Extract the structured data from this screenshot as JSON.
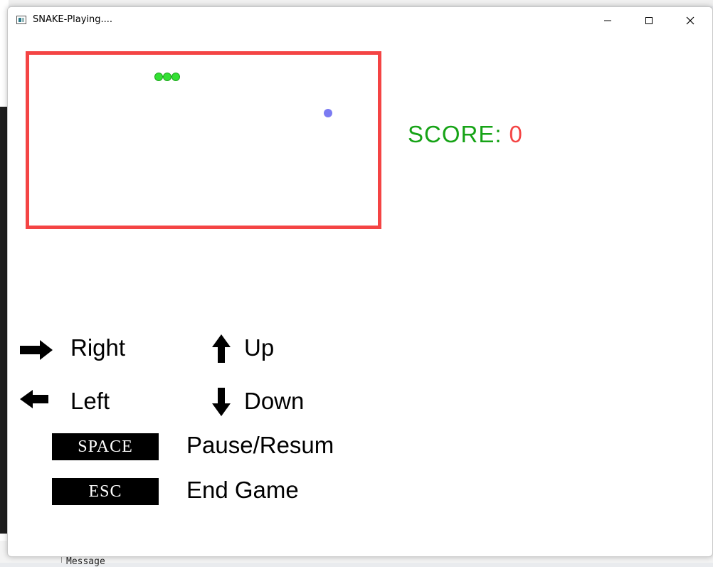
{
  "window": {
    "title": "SNAKE-Playing....",
    "buttons": {
      "minimize_icon": "minimize-icon",
      "maximize_icon": "maximize-icon",
      "close_icon": "close-icon"
    }
  },
  "colors": {
    "border": "#f44444",
    "snake": "#33e033",
    "food": "#7b7bf2",
    "score_label": "#16a316",
    "score_value": "#f44444"
  },
  "score": {
    "label": "SCORE:",
    "value": "0"
  },
  "controls": {
    "right_label": "Right",
    "up_label": "Up",
    "left_label": "Left",
    "down_label": "Down",
    "space_key": "SPACE",
    "space_action": "Pause/Resum",
    "esc_key": "ESC",
    "esc_action": "End Game"
  },
  "background": {
    "message_fragment": "Message"
  }
}
